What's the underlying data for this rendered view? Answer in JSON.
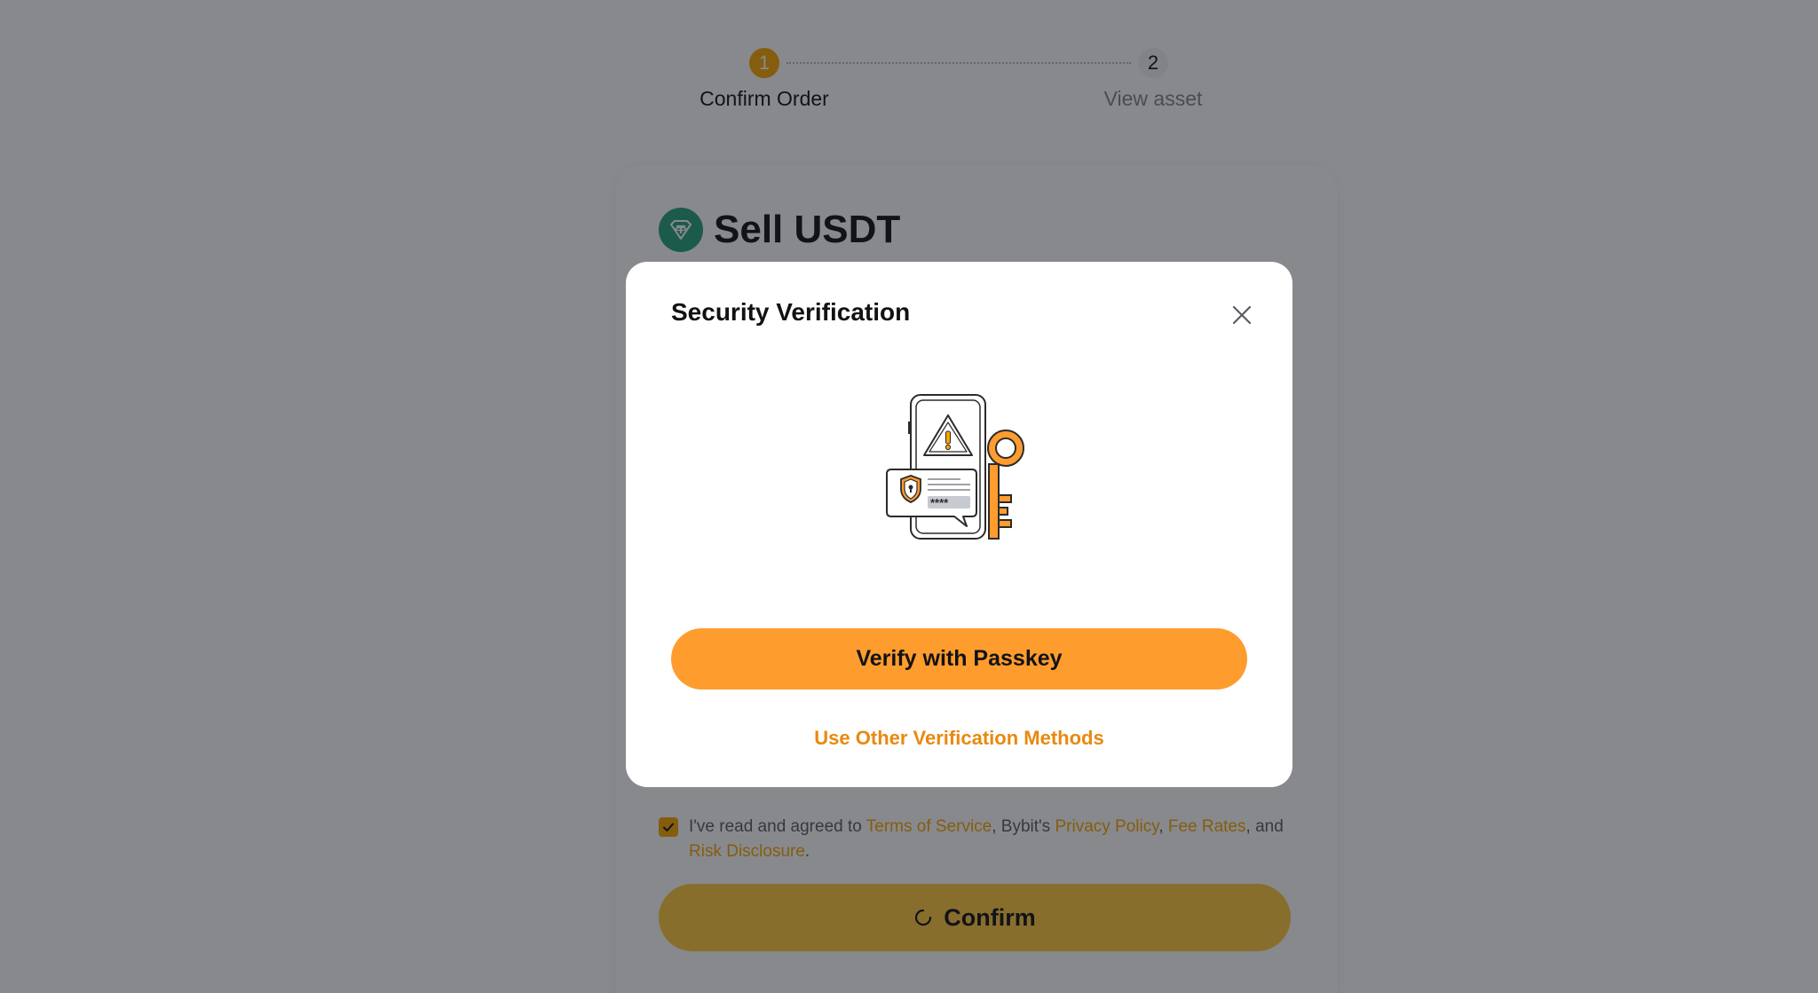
{
  "stepper": {
    "steps": [
      {
        "number": "1",
        "label": "Confirm Order"
      },
      {
        "number": "2",
        "label": "View asset"
      }
    ]
  },
  "order": {
    "title": "Sell USDT",
    "coin_icon": "tether-icon"
  },
  "agreement": {
    "prefix": "I've read and agreed to ",
    "terms": "Terms of Service",
    "sep1": ", Bybit's ",
    "privacy": "Privacy Policy",
    "sep2": ", ",
    "fees": "Fee Rates",
    "sep3": ", and ",
    "risk": "Risk Disclosure",
    "suffix": "."
  },
  "confirm": {
    "label": "Confirm"
  },
  "modal": {
    "title": "Security Verification",
    "primary_label": "Verify with Passkey",
    "secondary_label": "Use Other Verification Methods",
    "illustration": "phone-warning-key-illustration"
  },
  "colors": {
    "accent": "#f7a600",
    "primary_button": "#ff9c2e",
    "link": "#e8890f",
    "tether": "#26a17b"
  }
}
